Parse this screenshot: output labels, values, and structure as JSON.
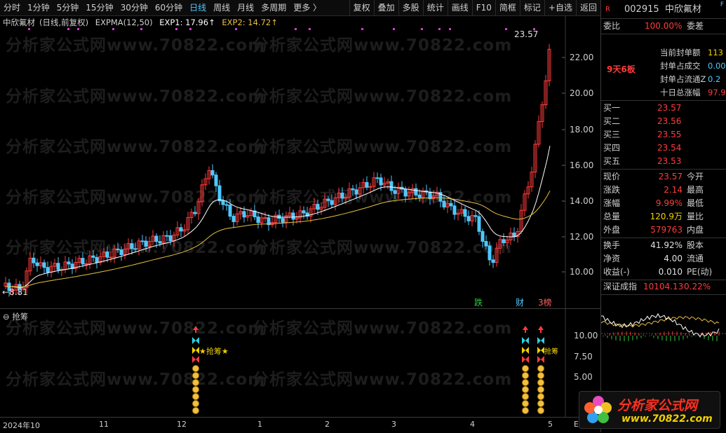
{
  "toolbar": {
    "left": [
      "分时",
      "1分钟",
      "5分钟",
      "15分钟",
      "30分钟",
      "60分钟",
      "日线",
      "周线",
      "月线",
      "多周期",
      "更多 〉"
    ],
    "selected": "日线",
    "right": [
      "复权",
      "叠加",
      "多股",
      "统计",
      "画线",
      "F10",
      "简框",
      "标记",
      "+自选",
      "返回"
    ]
  },
  "main": {
    "stock_name": "中欣氟材",
    "period_label": "(日线,前复权)",
    "indicator": "EXPMA(12,50)",
    "exp1": "EXP1: 17.96↑",
    "exp2": "EXP2: 14.72↑",
    "high_label": "23.57",
    "low_label": "←8.81",
    "y_ticks": [
      "22.00",
      "20.00",
      "18.00",
      "16.00",
      "14.00",
      "12.00",
      "10.00"
    ],
    "markers": [
      "跌",
      "财",
      "3榜"
    ]
  },
  "sub": {
    "title": "抢筹",
    "y_ticks": [
      "10.00",
      "7.50",
      "5.00"
    ],
    "signal_label": "★抢筹★",
    "signal_label_2": "抢筹"
  },
  "date_axis": [
    "2024年10",
    "11",
    "12",
    "1",
    "2",
    "3",
    "4",
    "5",
    "E"
  ],
  "watermark": "分析家公式网www.70822.com",
  "panel": {
    "code": "002915",
    "name": "中欣氟材",
    "badge": "F",
    "weibi_label": "委比",
    "weibi_value": "100.00%",
    "weicha_label": "委差",
    "board_text": "9天6板",
    "seal_rows": [
      {
        "label": "当前封单额",
        "value": "113"
      },
      {
        "label": "封单占成交",
        "value": "0.00"
      },
      {
        "label": "封单占流通Z",
        "value": "0.2"
      },
      {
        "label": "十日总涨幅",
        "value": "97.9"
      }
    ],
    "bids": [
      {
        "label": "买一",
        "price": "23.57"
      },
      {
        "label": "买二",
        "price": "23.56"
      },
      {
        "label": "买三",
        "price": "23.55"
      },
      {
        "label": "买四",
        "price": "23.54"
      },
      {
        "label": "买五",
        "price": "23.53"
      }
    ],
    "stats": [
      {
        "label": "现价",
        "value": "23.57",
        "label2": "今开",
        "color": "red"
      },
      {
        "label": "涨跌",
        "value": "2.14",
        "label2": "最高",
        "color": "red"
      },
      {
        "label": "涨幅",
        "value": "9.99%",
        "label2": "最低",
        "color": "red"
      },
      {
        "label": "总量",
        "value": "120.9万",
        "label2": "量比",
        "color": "yellow"
      },
      {
        "label": "外盘",
        "value": "579763",
        "label2": "内盘",
        "color": "red"
      }
    ],
    "stats2": [
      {
        "label": "换手",
        "value": "41.92%",
        "label2": "股本"
      },
      {
        "label": "净资",
        "value": "4.00",
        "label2": "流通"
      },
      {
        "label": "收益(-)",
        "value": "0.010",
        "label2": "PE(动)"
      }
    ],
    "index_name": "深证成指",
    "index_value": "10104.13",
    "index_change": "0.22%",
    "logo_text": "分析家公式网",
    "logo_url": "www.70822.com"
  },
  "colors": {
    "up": "#ff3c3c",
    "down": "#4ec8ff",
    "exp1": "#ffffff",
    "exp2": "#e8c040"
  }
}
